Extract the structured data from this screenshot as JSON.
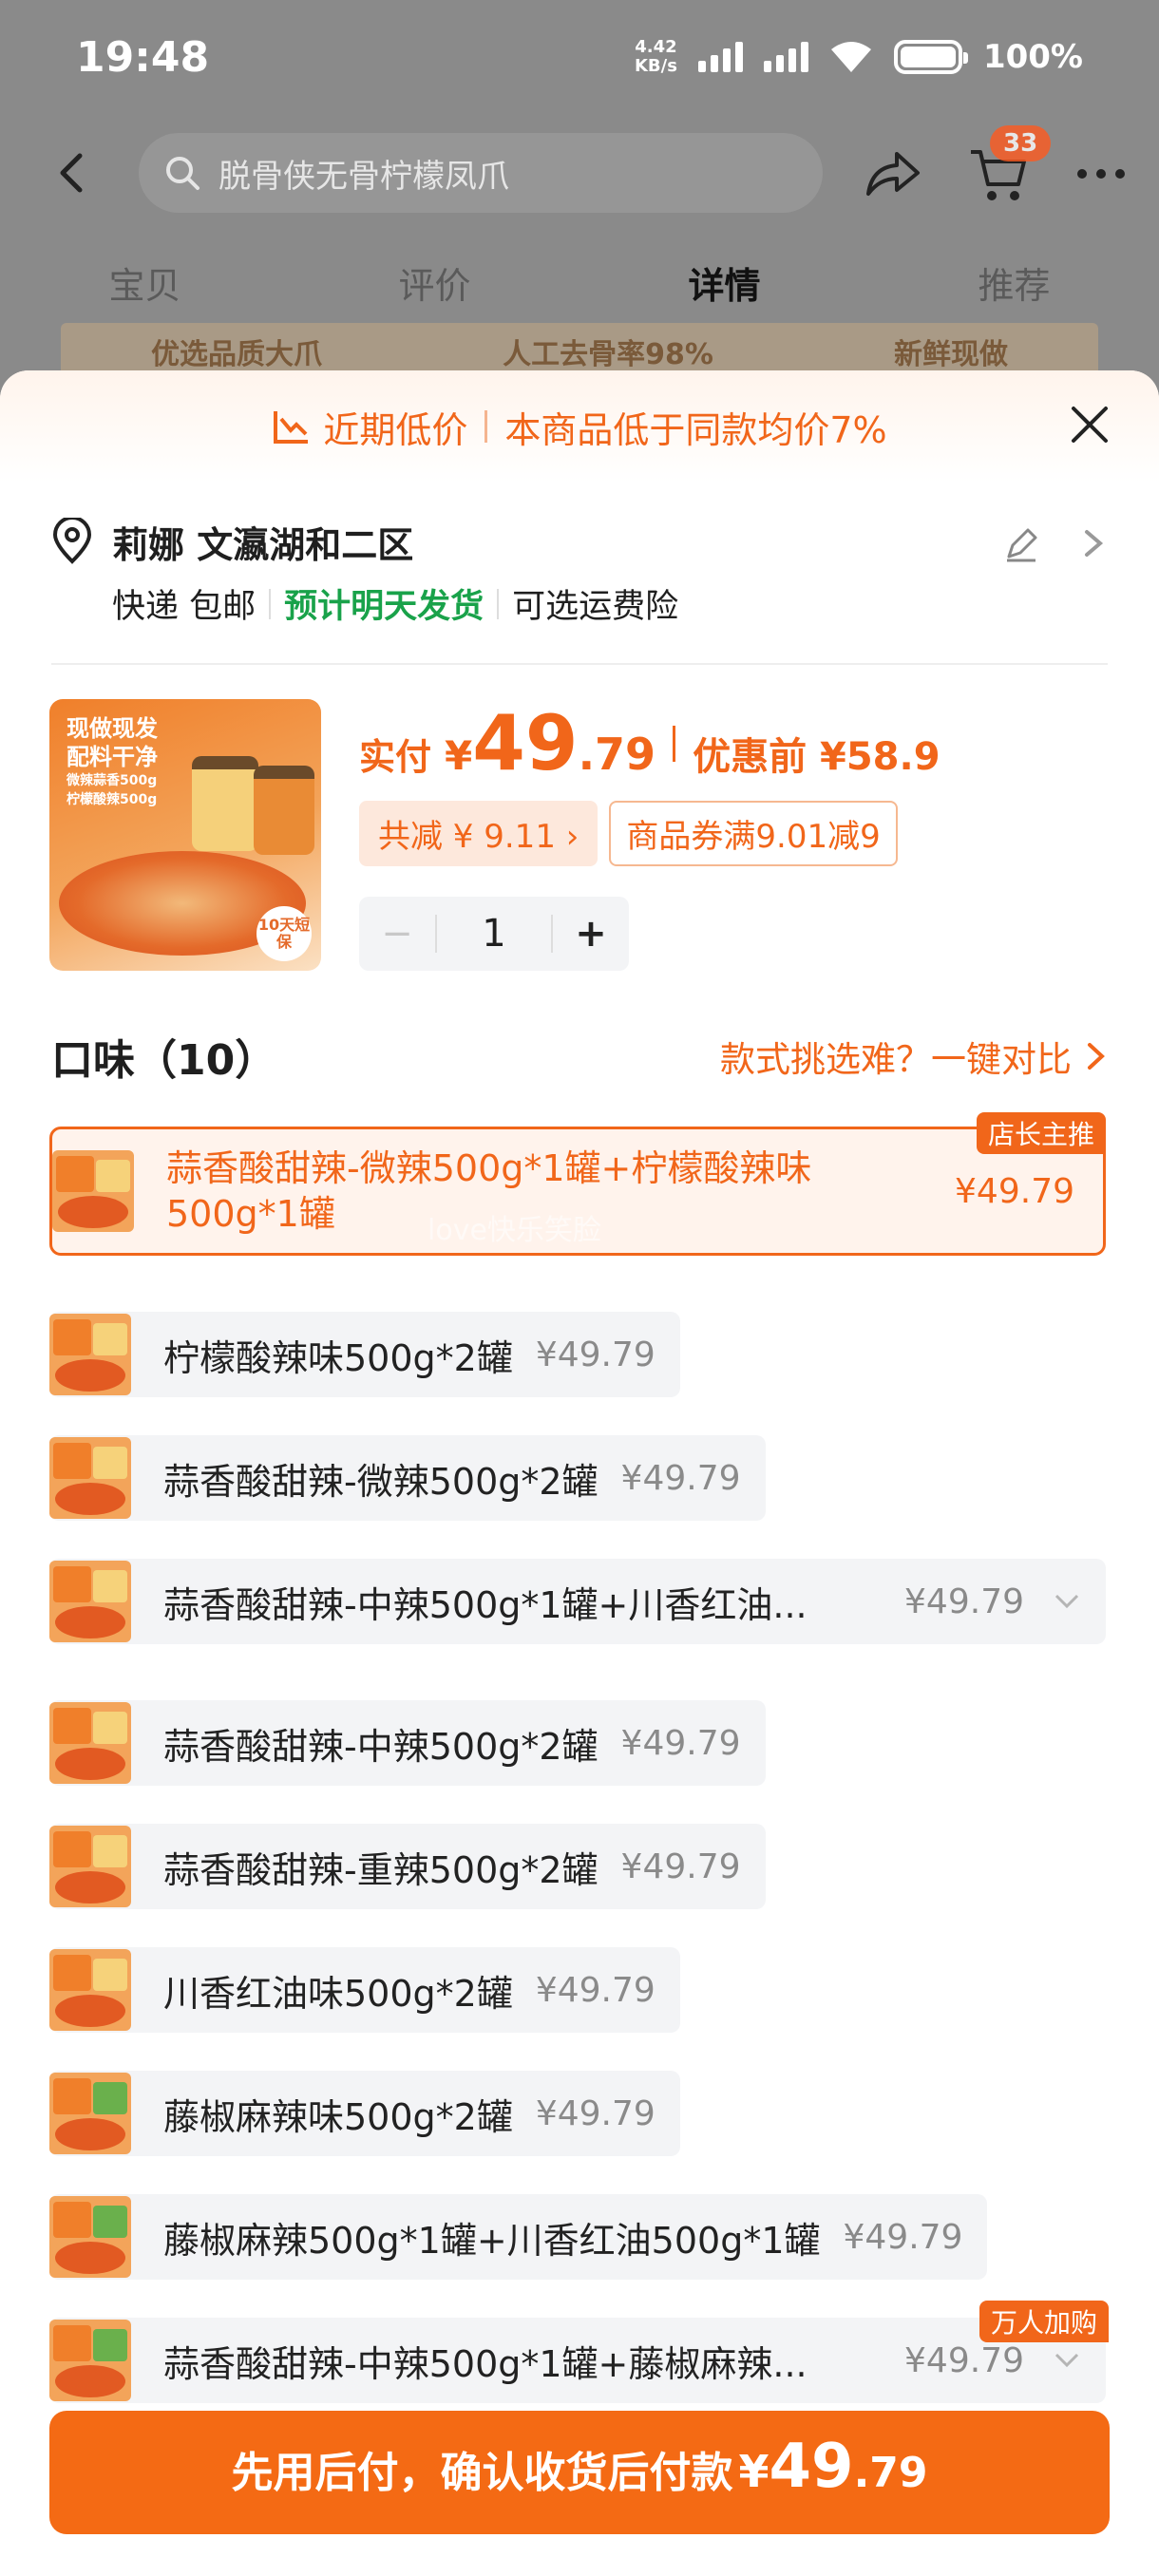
{
  "status": {
    "time": "19:48",
    "net_speed_value": "4.42",
    "net_speed_unit": "KB/s",
    "battery": "100%"
  },
  "nav": {
    "search_text": "脱骨侠无骨柠檬凤爪",
    "cart_count": "33",
    "tabs": [
      "宝贝",
      "评价",
      "详情",
      "推荐"
    ],
    "active_tab": "详情",
    "peek": [
      "优选品质大爪",
      "人工去骨率98%",
      "新鲜现做"
    ]
  },
  "sheet": {
    "low_price_label": "近期低价",
    "low_price_desc": "本商品低于同款均价7%",
    "address": {
      "name": "莉娜 文瀛湖和二区",
      "shipping": "快递 包邮",
      "dispatch": "预计明天发货",
      "insurance": "可选运费险"
    },
    "product": {
      "thumb_title_1": "现做现发",
      "thumb_title_2": "配料干净",
      "thumb_line_1": "微辣蒜香500g",
      "thumb_line_2": "柠檬酸辣500g",
      "thumb_tag": "10天短保",
      "pay_label": "实付",
      "currency": "¥",
      "price_int": "49",
      "price_dec": ".79",
      "before_label": "优惠前 ¥58.9",
      "discount_chip": "共减 ¥ 9.11",
      "coupon_chip": "商品券满9.01减9",
      "quantity": "1",
      "minus": "−",
      "plus": "+"
    },
    "flavor": {
      "title": "口味（10）",
      "compare": "款式挑选难？一键对比"
    },
    "watermark": "love快乐笑脸",
    "options": [
      {
        "label": "蒜香酸甜辣-微辣500g*1罐+柠檬酸辣味500g*1罐",
        "price": "¥49.79",
        "tag": "店长主推"
      },
      {
        "label": "柠檬酸辣味500g*2罐",
        "price": "¥49.79"
      },
      {
        "label": "蒜香酸甜辣-微辣500g*2罐",
        "price": "¥49.79"
      },
      {
        "label": "蒜香酸甜辣-中辣500g*1罐+川香红油...",
        "price": "¥49.79"
      },
      {
        "label": "蒜香酸甜辣-中辣500g*2罐",
        "price": "¥49.79"
      },
      {
        "label": "蒜香酸甜辣-重辣500g*2罐",
        "price": "¥49.79"
      },
      {
        "label": "川香红油味500g*2罐",
        "price": "¥49.79"
      },
      {
        "label": "藤椒麻辣味500g*2罐",
        "price": "¥49.79"
      },
      {
        "label": "藤椒麻辣500g*1罐+川香红油500g*1罐",
        "price": "¥49.79"
      },
      {
        "label": "蒜香酸甜辣-中辣500g*1罐+藤椒麻辣...",
        "price": "¥49.79",
        "tag": "万人加购"
      }
    ],
    "cta": {
      "text": "先用后付，确认收货后付款",
      "currency": "¥",
      "price_int": "49",
      "price_dec": ".79"
    }
  },
  "colors": {
    "accent": "#f1661a",
    "green": "#19a24a",
    "cta": "#f46a14"
  }
}
